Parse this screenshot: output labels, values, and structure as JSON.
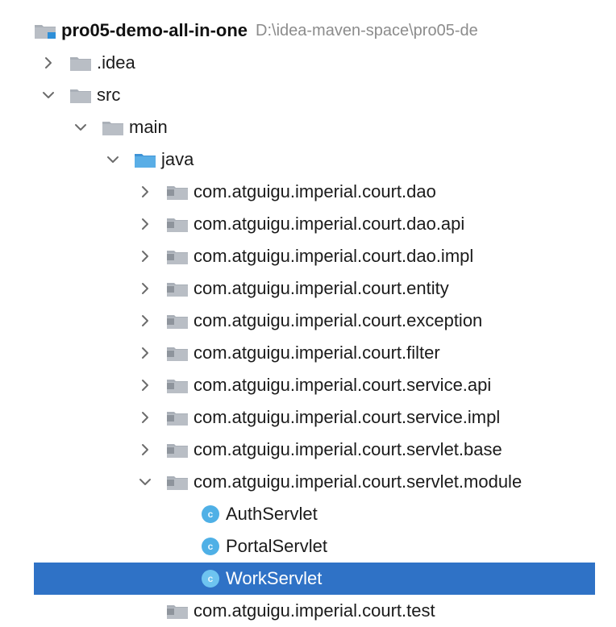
{
  "project": {
    "name": "pro05-demo-all-in-one",
    "path": "D:\\idea-maven-space\\pro05-de"
  },
  "icons": {
    "chevron_right": "chevron-right-icon",
    "chevron_down": "chevron-down-icon",
    "folder": "folder-icon",
    "package": "package-folder-icon",
    "source_root": "source-root-folder-icon",
    "module": "module-folder-icon",
    "class": "class-c-icon"
  },
  "colors": {
    "selection": "#2f72c6",
    "folder_gray": "#aab0b8",
    "folder_blue": "#4a9fde",
    "class_badge": "#4fb0e6"
  },
  "tree": {
    "idea": ".idea",
    "src": "src",
    "main": "main",
    "java": "java",
    "packages": {
      "dao": "com.atguigu.imperial.court.dao",
      "dao_api": "com.atguigu.imperial.court.dao.api",
      "dao_impl": "com.atguigu.imperial.court.dao.impl",
      "entity": "com.atguigu.imperial.court.entity",
      "exception": "com.atguigu.imperial.court.exception",
      "filter": "com.atguigu.imperial.court.filter",
      "service_api": "com.atguigu.imperial.court.service.api",
      "service_impl": "com.atguigu.imperial.court.service.impl",
      "servlet_base": "com.atguigu.imperial.court.servlet.base",
      "servlet_module": "com.atguigu.imperial.court.servlet.module",
      "test": "com.atguigu.imperial.court.test"
    },
    "classes": {
      "auth": "AuthServlet",
      "portal": "PortalServlet",
      "work": "WorkServlet"
    },
    "class_badge_letter": "c"
  }
}
